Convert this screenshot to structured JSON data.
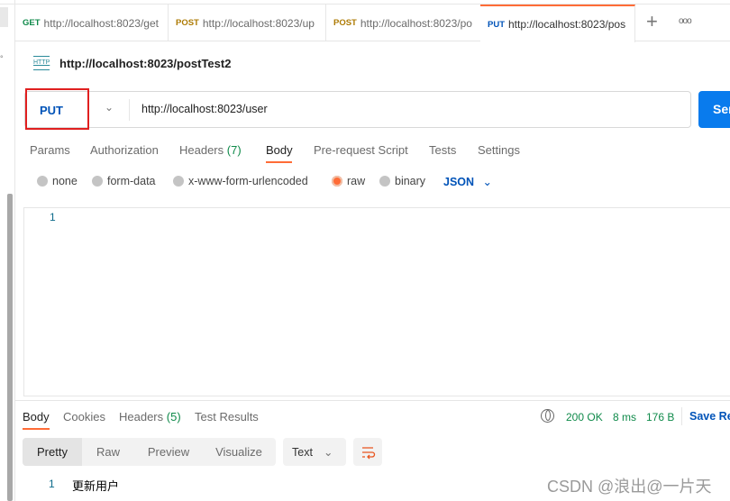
{
  "tabs": [
    {
      "method": "GET",
      "url": "http://localhost:8023/get",
      "color": "#0f8a4a"
    },
    {
      "method": "POST",
      "url": "http://localhost:8023/up",
      "color": "#ad7a03"
    },
    {
      "method": "POST",
      "url": "http://localhost:8023/po",
      "color": "#ad7a03"
    },
    {
      "method": "PUT",
      "url": "http://localhost:8023/pos",
      "color": "#0053b8"
    }
  ],
  "new_tab": "+",
  "more": "ooo",
  "request": {
    "name": "http://localhost:8023/postTest2",
    "http_icon": "HTTP",
    "method": "PUT",
    "url": "http://localhost:8023/user",
    "send": "Send"
  },
  "req_tabs": [
    "Params",
    "Authorization",
    "Headers",
    "Body",
    "Pre-request Script",
    "Tests",
    "Settings"
  ],
  "headers_count": "(7)",
  "body_types": [
    "none",
    "form-data",
    "x-www-form-urlencoded",
    "raw",
    "binary"
  ],
  "body_format": "JSON",
  "editor": {
    "line": "1"
  },
  "response": {
    "tabs": [
      "Body",
      "Cookies",
      "Headers",
      "Test Results"
    ],
    "headers_count": "(5)",
    "status": "200 OK",
    "time": "8 ms",
    "size": "176 B",
    "save": "Save Re",
    "views": [
      "Pretty",
      "Raw",
      "Preview",
      "Visualize"
    ],
    "format": "Text",
    "line": "1",
    "content": "更新用户"
  },
  "watermark": "CSDN @浪出@一片天",
  "colors": {
    "accent": "#ff6c37",
    "send": "#097bed",
    "highlight": "#e02020"
  }
}
